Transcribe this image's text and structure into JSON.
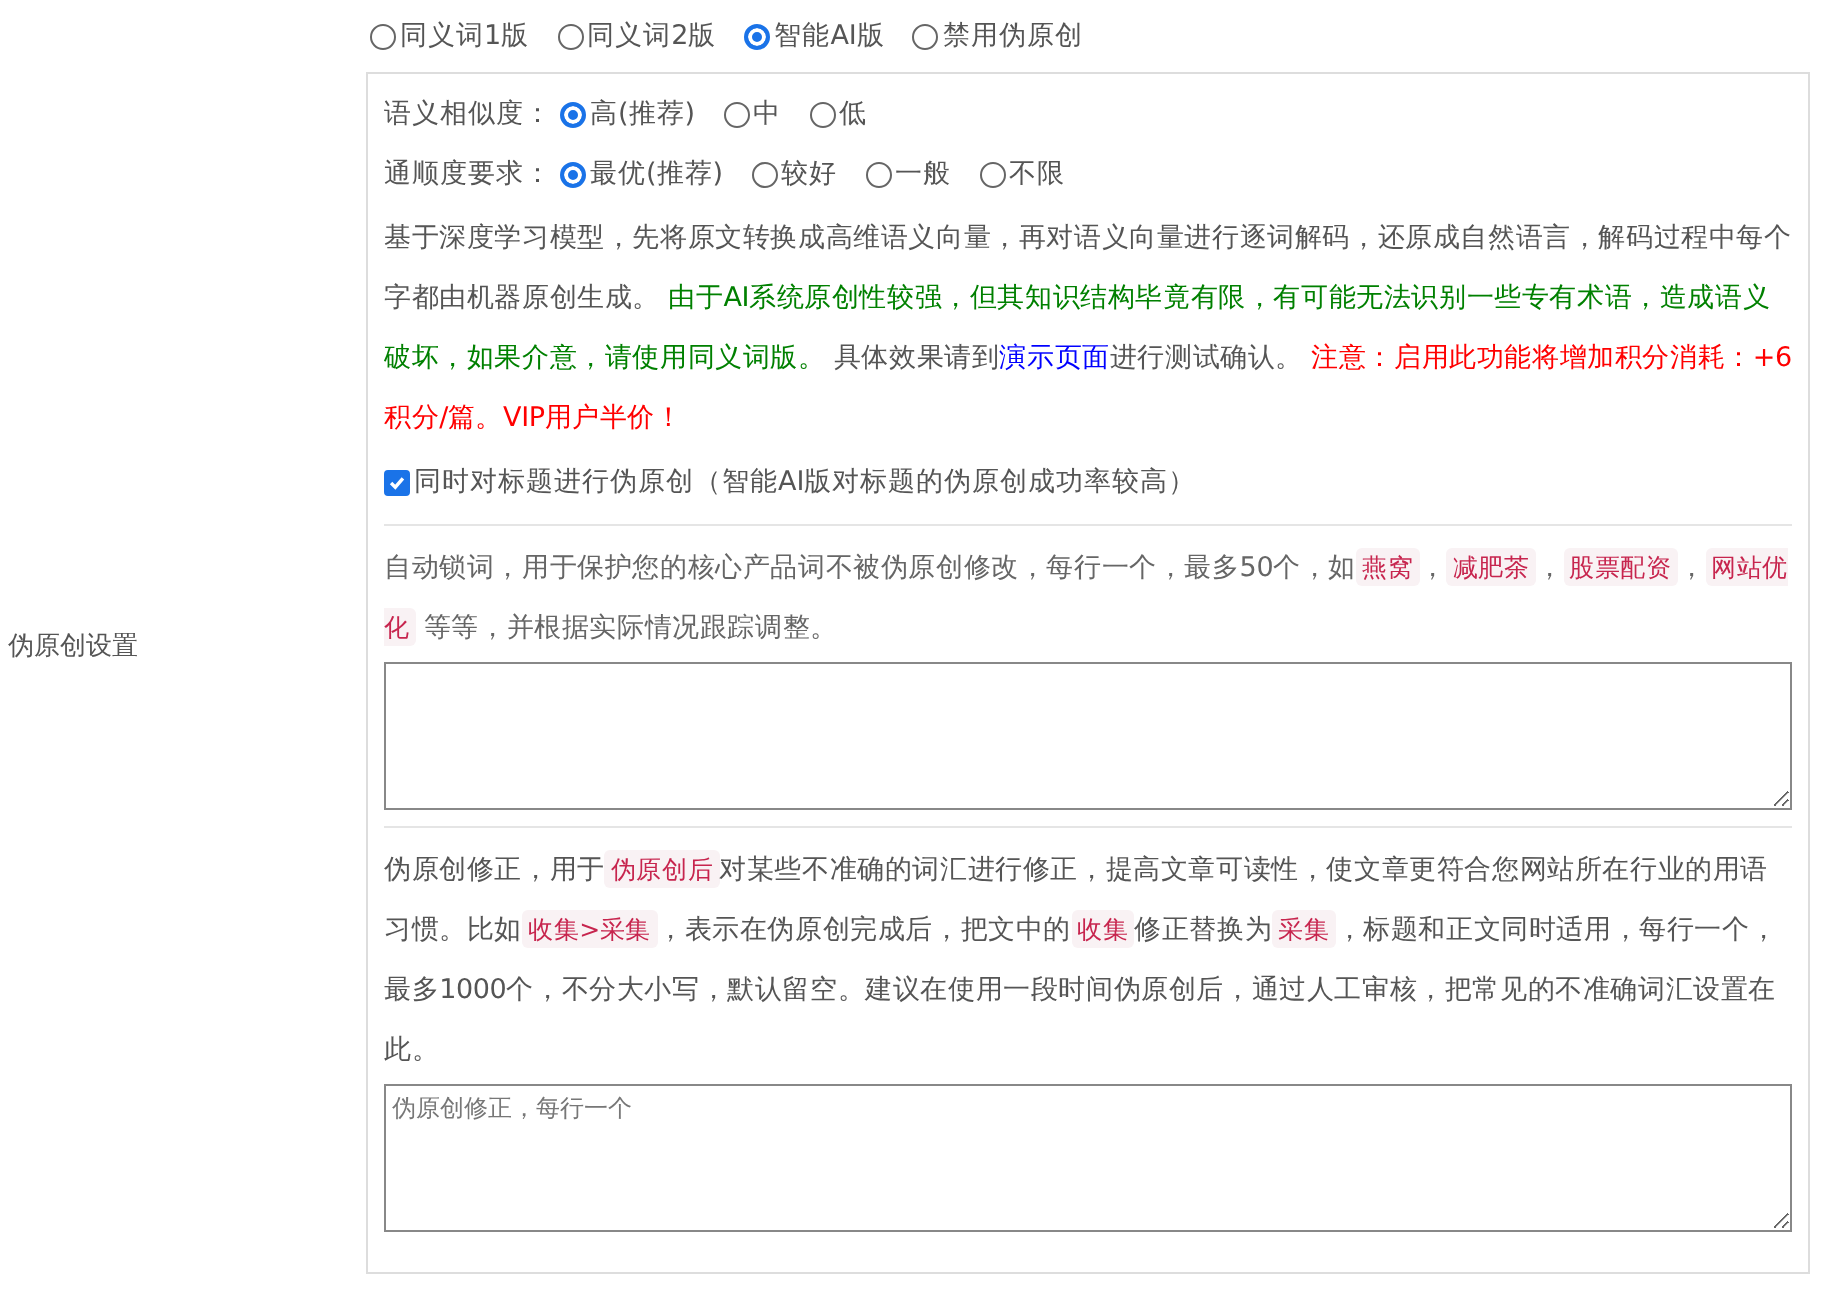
{
  "section_label": "伪原创设置",
  "modes": [
    {
      "label": "同义词1版",
      "selected": false
    },
    {
      "label": "同义词2版",
      "selected": false
    },
    {
      "label": "智能AI版",
      "selected": true
    },
    {
      "label": "禁用伪原创",
      "selected": false
    }
  ],
  "similarity": {
    "label": "语义相似度：",
    "options": [
      {
        "label": "高(推荐)",
        "selected": true
      },
      {
        "label": "中",
        "selected": false
      },
      {
        "label": "低",
        "selected": false
      }
    ]
  },
  "fluency": {
    "label": "通顺度要求：",
    "options": [
      {
        "label": "最优(推荐)",
        "selected": true
      },
      {
        "label": "较好",
        "selected": false
      },
      {
        "label": "一般",
        "selected": false
      },
      {
        "label": "不限",
        "selected": false
      }
    ]
  },
  "ai_description": [
    {
      "kind": "text",
      "text": "基于深度学习模型，先将原文转换成高维语义向量，再对语义向量进行逐词解码，还原成自然语言，解码过程中每个字都由机器原创生成。 "
    },
    {
      "kind": "note",
      "text": "由于AI系统原创性较强，但其知识结构毕竟有限，有可能无法识别一些专有术语，造成语义破坏，如果介意，请使用同义词版。"
    },
    {
      "kind": "text",
      "text": " 具体效果请到"
    },
    {
      "kind": "link",
      "text": "演示页面"
    },
    {
      "kind": "text",
      "text": "进行测试确认。 "
    },
    {
      "kind": "warning",
      "text": "注意：启用此功能将增加积分消耗：+6积分/篇。VIP用户半价！"
    }
  ],
  "title_option": {
    "label": "同时对标题进行伪原创（智能AI版对标题的伪原创成功率较高）",
    "checked": true
  },
  "lock_words": {
    "description": [
      {
        "kind": "text",
        "text": "自动锁词，用于保护您的核心产品词不被伪原创修改，每行一个，最多50个，如"
      },
      {
        "kind": "code",
        "text": "燕窝"
      },
      {
        "kind": "text",
        "text": "，"
      },
      {
        "kind": "code",
        "text": "减肥茶"
      },
      {
        "kind": "text",
        "text": "，"
      },
      {
        "kind": "code",
        "text": "股票配资"
      },
      {
        "kind": "text",
        "text": "，"
      },
      {
        "kind": "code",
        "text": "网站优化"
      },
      {
        "kind": "text",
        "text": " 等等，并根据实际情况跟踪调整。"
      }
    ]
  },
  "correction": {
    "description": [
      {
        "kind": "text",
        "text": "伪原创修正，用于"
      },
      {
        "kind": "code",
        "text": "伪原创后"
      },
      {
        "kind": "text",
        "text": "对某些不准确的词汇进行修正，提高文章可读性，使文章更符合您网站所在行业的用语习惯。比如"
      },
      {
        "kind": "code",
        "text": "收集>采集"
      },
      {
        "kind": "text",
        "text": "，表示在伪原创完成后，把文中的"
      },
      {
        "kind": "code",
        "text": "收集"
      },
      {
        "kind": "text",
        "text": "修正替换为"
      },
      {
        "kind": "code",
        "text": "采集"
      },
      {
        "kind": "text",
        "text": "，标题和正文同时适用，每行一个，最多1000个，不分大小写，默认留空。建议在使用一段时间伪原创后，通过人工审核，把常见的不准确词汇设置在此。"
      }
    ],
    "placeholder": "伪原创修正，每行一个"
  }
}
